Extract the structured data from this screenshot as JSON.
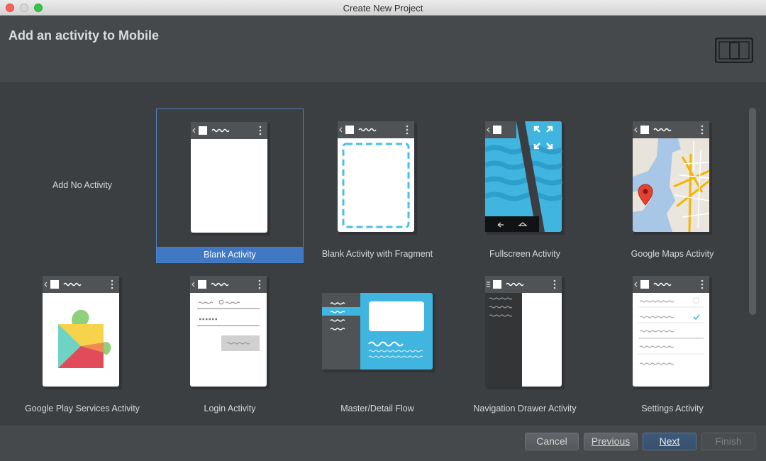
{
  "window": {
    "title": "Create New Project"
  },
  "header": {
    "title": "Add an activity to Mobile",
    "device_icon": "tablet-phone-icon"
  },
  "templates": [
    {
      "label": "Add No Activity"
    },
    {
      "label": "Blank Activity",
      "selected": true
    },
    {
      "label": "Blank Activity with Fragment"
    },
    {
      "label": "Fullscreen Activity"
    },
    {
      "label": "Google Maps Activity"
    },
    {
      "label": "Google Play Services Activity"
    },
    {
      "label": "Login Activity"
    },
    {
      "label": "Master/Detail Flow"
    },
    {
      "label": "Navigation Drawer Activity"
    },
    {
      "label": "Settings Activity"
    }
  ],
  "buttons": {
    "cancel": "Cancel",
    "previous": "Previous",
    "next": "Next",
    "finish": "Finish"
  },
  "colors": {
    "selection": "#4178c3",
    "accent_blue": "#3fb5e0",
    "background": "#3c3f41"
  }
}
